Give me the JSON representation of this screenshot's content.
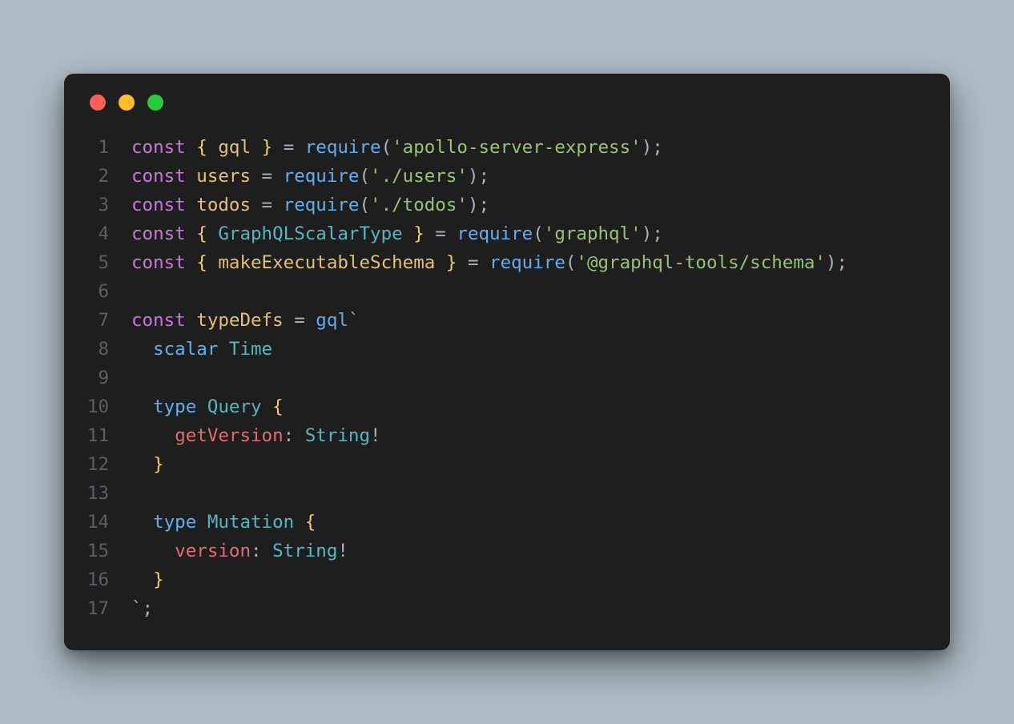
{
  "window_controls": {
    "close": "close",
    "minimize": "minimize",
    "zoom": "zoom"
  },
  "colors": {
    "background_page": "#aebdc8",
    "background_window": "#1e1e1e",
    "red": "#ff5f56",
    "yellow": "#ffbd2e",
    "green": "#27c93f",
    "line_number": "#5b5f66",
    "default": "#abb2bf",
    "keyword": "#c678dd",
    "identifier": "#e5c07b",
    "class": "#56b6c2",
    "function": "#61afef",
    "string": "#98c379",
    "brace": "#f6c76d",
    "gql_type": "#56b6c2",
    "gql_name": "#e06c75"
  },
  "code": {
    "language": "javascript",
    "lines": [
      {
        "n": 1,
        "tokens": [
          [
            "kw",
            "const"
          ],
          [
            "punc",
            " "
          ],
          [
            "brace",
            "{"
          ],
          [
            "punc",
            " "
          ],
          [
            "ident",
            "gql"
          ],
          [
            "punc",
            " "
          ],
          [
            "brace",
            "}"
          ],
          [
            "punc",
            " = "
          ],
          [
            "fn",
            "require"
          ],
          [
            "punc",
            "("
          ],
          [
            "str",
            "'apollo-server-express'"
          ],
          [
            "punc",
            ");"
          ]
        ]
      },
      {
        "n": 2,
        "tokens": [
          [
            "kw",
            "const"
          ],
          [
            "punc",
            " "
          ],
          [
            "ident",
            "users"
          ],
          [
            "punc",
            " = "
          ],
          [
            "fn",
            "require"
          ],
          [
            "punc",
            "("
          ],
          [
            "str",
            "'./users'"
          ],
          [
            "punc",
            ");"
          ]
        ]
      },
      {
        "n": 3,
        "tokens": [
          [
            "kw",
            "const"
          ],
          [
            "punc",
            " "
          ],
          [
            "ident",
            "todos"
          ],
          [
            "punc",
            " = "
          ],
          [
            "fn",
            "require"
          ],
          [
            "punc",
            "("
          ],
          [
            "str",
            "'./todos'"
          ],
          [
            "punc",
            ");"
          ]
        ]
      },
      {
        "n": 4,
        "tokens": [
          [
            "kw",
            "const"
          ],
          [
            "punc",
            " "
          ],
          [
            "brace",
            "{"
          ],
          [
            "punc",
            " "
          ],
          [
            "cls",
            "GraphQLScalarType"
          ],
          [
            "punc",
            " "
          ],
          [
            "brace",
            "}"
          ],
          [
            "punc",
            " = "
          ],
          [
            "fn",
            "require"
          ],
          [
            "punc",
            "("
          ],
          [
            "str",
            "'graphql'"
          ],
          [
            "punc",
            ");"
          ]
        ]
      },
      {
        "n": 5,
        "tokens": [
          [
            "kw",
            "const"
          ],
          [
            "punc",
            " "
          ],
          [
            "brace",
            "{"
          ],
          [
            "punc",
            " "
          ],
          [
            "ident",
            "makeExecutableSchema"
          ],
          [
            "punc",
            " "
          ],
          [
            "brace",
            "}"
          ],
          [
            "punc",
            " = "
          ],
          [
            "fn",
            "require"
          ],
          [
            "punc",
            "("
          ],
          [
            "str",
            "'@graphql-tools/schema'"
          ],
          [
            "punc",
            ");"
          ]
        ]
      },
      {
        "n": 6,
        "tokens": []
      },
      {
        "n": 7,
        "tokens": [
          [
            "kw",
            "const"
          ],
          [
            "punc",
            " "
          ],
          [
            "ident",
            "typeDefs"
          ],
          [
            "punc",
            " = "
          ],
          [
            "fn",
            "gql"
          ],
          [
            "str",
            "`"
          ]
        ]
      },
      {
        "n": 8,
        "tokens": [
          [
            "punc",
            "  "
          ],
          [
            "gql-kw",
            "scalar"
          ],
          [
            "punc",
            " "
          ],
          [
            "gql-type",
            "Time"
          ]
        ]
      },
      {
        "n": 9,
        "tokens": []
      },
      {
        "n": 10,
        "tokens": [
          [
            "punc",
            "  "
          ],
          [
            "gql-kw",
            "type"
          ],
          [
            "punc",
            " "
          ],
          [
            "gql-type",
            "Query"
          ],
          [
            "punc",
            " "
          ],
          [
            "brace",
            "{"
          ]
        ]
      },
      {
        "n": 11,
        "tokens": [
          [
            "punc",
            "    "
          ],
          [
            "gql-name",
            "getVersion"
          ],
          [
            "punc",
            ": "
          ],
          [
            "gql-type",
            "String"
          ],
          [
            "punc",
            "!"
          ]
        ]
      },
      {
        "n": 12,
        "tokens": [
          [
            "punc",
            "  "
          ],
          [
            "brace",
            "}"
          ]
        ]
      },
      {
        "n": 13,
        "tokens": []
      },
      {
        "n": 14,
        "tokens": [
          [
            "punc",
            "  "
          ],
          [
            "gql-kw",
            "type"
          ],
          [
            "punc",
            " "
          ],
          [
            "gql-type",
            "Mutation"
          ],
          [
            "punc",
            " "
          ],
          [
            "brace",
            "{"
          ]
        ]
      },
      {
        "n": 15,
        "tokens": [
          [
            "punc",
            "    "
          ],
          [
            "gql-name",
            "version"
          ],
          [
            "punc",
            ": "
          ],
          [
            "gql-type",
            "String"
          ],
          [
            "punc",
            "!"
          ]
        ]
      },
      {
        "n": 16,
        "tokens": [
          [
            "punc",
            "  "
          ],
          [
            "brace",
            "}"
          ]
        ]
      },
      {
        "n": 17,
        "tokens": [
          [
            "str",
            "`"
          ],
          [
            "punc",
            ";"
          ]
        ]
      }
    ]
  }
}
